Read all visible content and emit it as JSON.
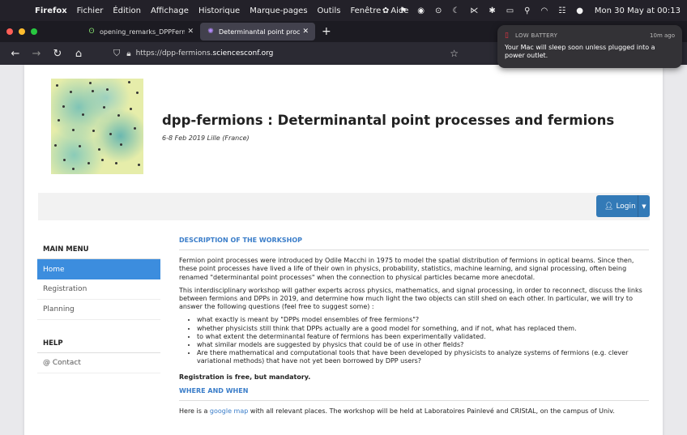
{
  "menubar": {
    "app": "Firefox",
    "items": [
      "Fichier",
      "Édition",
      "Affichage",
      "Historique",
      "Marque-pages",
      "Outils",
      "Fenêtre",
      "Aide"
    ],
    "clock": "Mon 30 May at 00:13"
  },
  "tabs": [
    {
      "label": "opening_remarks_DPPFermions"
    },
    {
      "label": "Determinantal point processes and"
    }
  ],
  "urlbar": {
    "prefix": "https://dpp-fermions.",
    "host": "sciencesconf.org"
  },
  "notification": {
    "title": "LOW BATTERY",
    "time": "10m ago",
    "body": "Your Mac will sleep soon unless plugged into a power outlet."
  },
  "site": {
    "title": "dpp-fermions : Determinantal point processes and fermions",
    "date": "6-8 Feb 2019 Lille (France)",
    "login": "Login"
  },
  "sidebar": {
    "main_menu": "MAIN MENU",
    "items": [
      "Home",
      "Registration",
      "Planning"
    ],
    "help": "HELP",
    "contact": "@ Contact"
  },
  "main": {
    "description_title": "DESCRIPTION OF THE WORKSHOP",
    "para1": "Fermion point processes were introduced by Odile Macchi in 1975 to model the spatial distribution of fermions in optical beams. Since then, these point processes have lived a life of their own in physics, probability, statistics, machine learning, and signal processing, often being renamed \"determinantal point processes\" when the connection to physical particles became more anecdotal.",
    "para2": "This interdisciplinary workshop will gather experts across physics, mathematics, and signal processing, in order to reconnect, discuss the links between fermions and DPPs in 2019, and determine how much light the two objects can still shed on each other. In particular, we will try to answer the following questions (feel free to suggest some) :",
    "bullets": [
      "what exactly is meant by \"DPPs model ensembles of free fermions\"?",
      "whether physicists still think that DPPs actually are a good model for something, and if not, what has replaced them.",
      "to what extent the determinantal feature of fermions has been experimentally validated.",
      "what similar models are suggested by physics that could be of use in other fields?",
      "Are there mathematical and computational tools that have been developed by physicists to analyze systems of fermions (e.g. clever variational methods) that have not yet been borrowed by DPP users?"
    ],
    "registration": "Registration is free, but mandatory.",
    "where_title": "WHERE AND WHEN",
    "where_pre": "Here is a ",
    "where_link": "google map",
    "where_post": " with all relevant places. The workshop will be held at Laboratoires Painlevé and CRIStAL, on the campus of Univ."
  }
}
